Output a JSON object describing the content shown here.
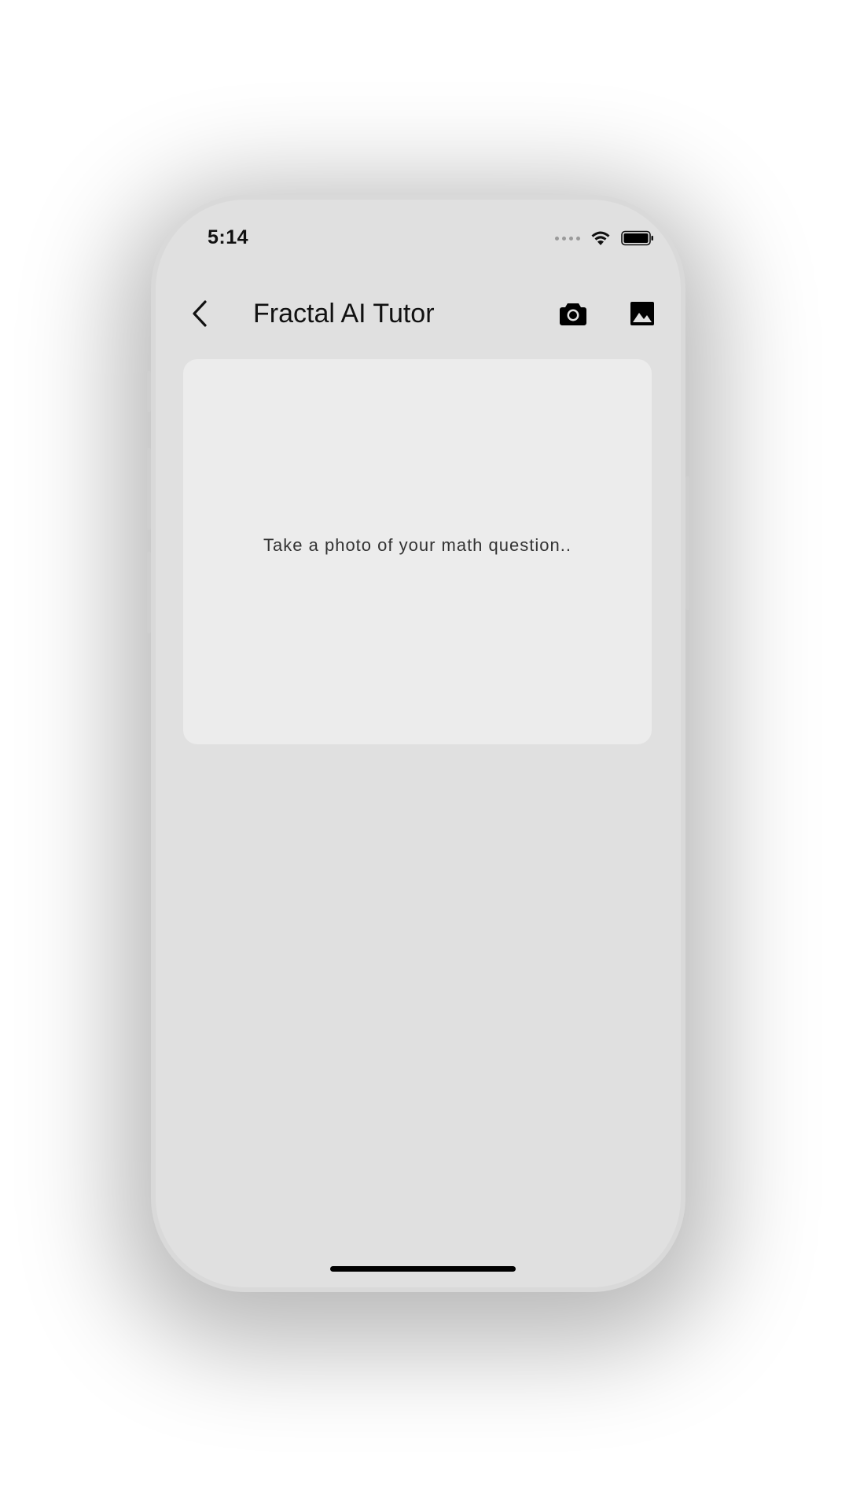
{
  "status_bar": {
    "time": "5:14",
    "icons": [
      "cellular-signal-icon",
      "wifi-icon",
      "battery-icon"
    ]
  },
  "app_bar": {
    "back_icon": "chevron-left-icon",
    "title": "Fractal AI Tutor",
    "actions": [
      "camera-icon",
      "image-gallery-icon"
    ]
  },
  "main": {
    "photo_prompt": "Take a photo of your math question.."
  },
  "colors": {
    "screen_background": "#e0e0e0",
    "card_background": "#ececec",
    "text_primary": "#111111",
    "home_indicator": "#000000"
  }
}
